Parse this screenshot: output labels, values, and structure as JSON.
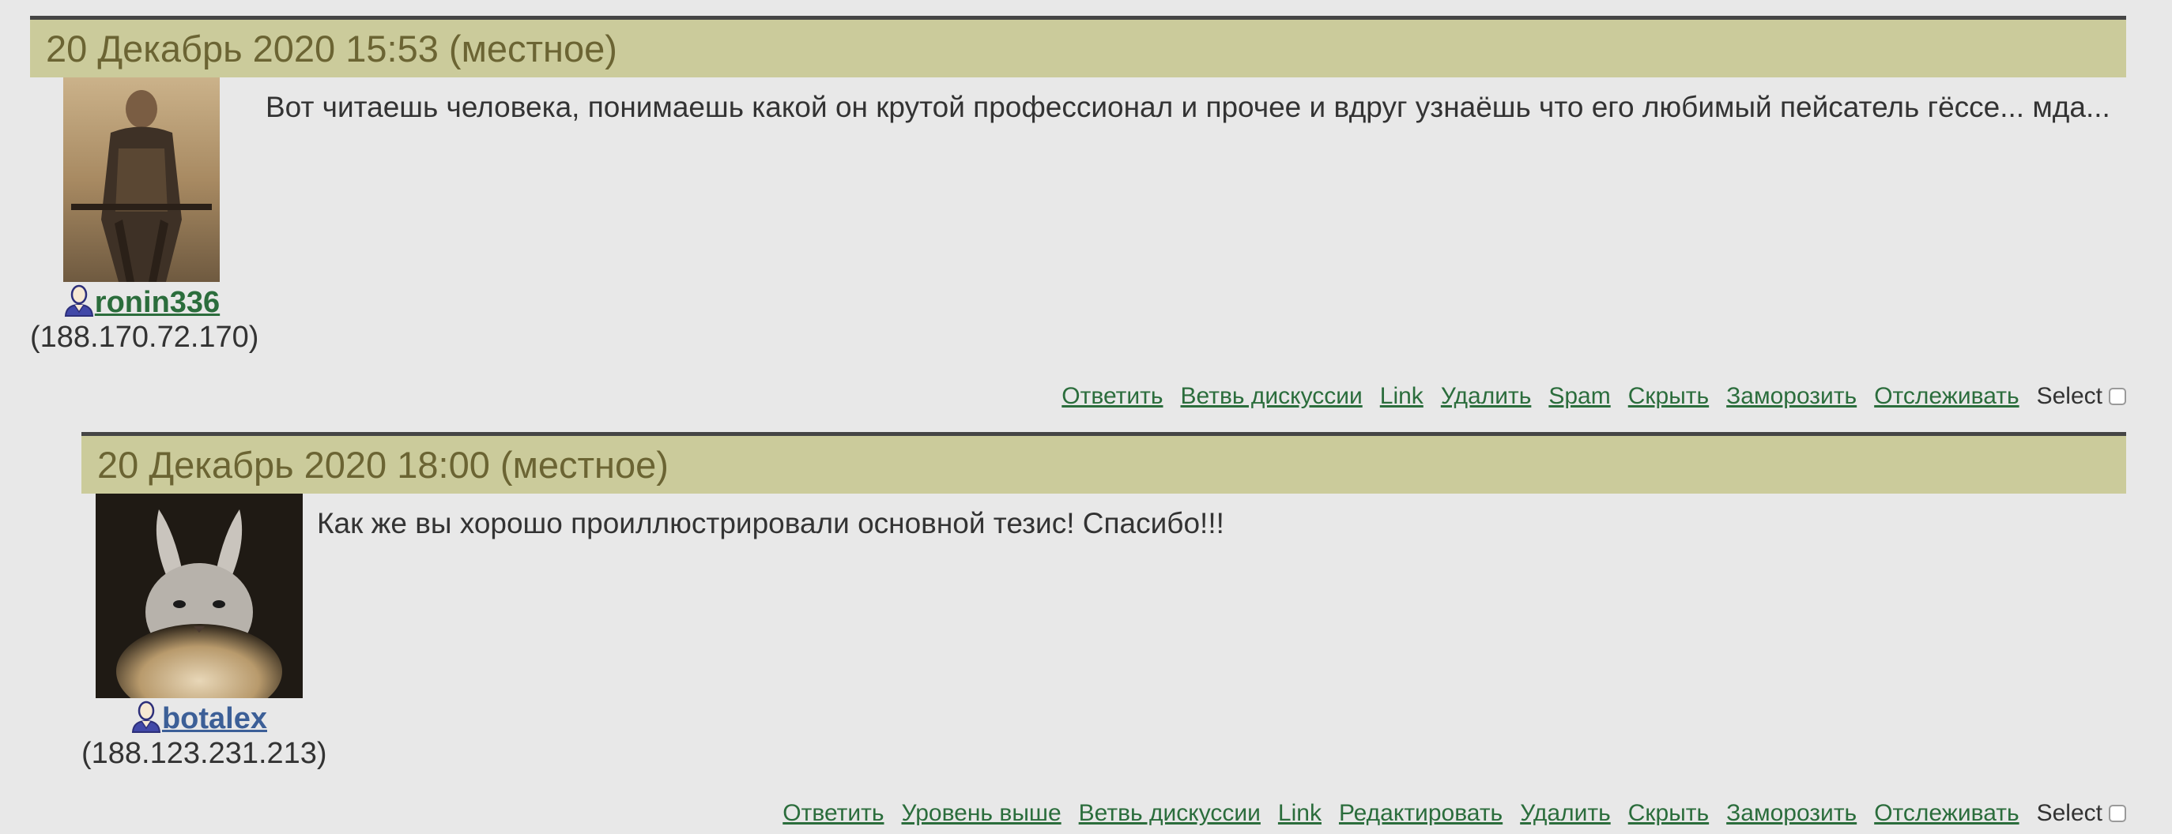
{
  "comments": [
    {
      "date": "20 Декабрь 2020 15:53 (местное)",
      "avatar_icon": "avatar-samurai",
      "user_icon": "user-icon",
      "username": "ronin336",
      "ip": "(188.170.72.170)",
      "text": "Вот читаешь человека, понимаешь какой он крутой профессионал и прочее и вдруг узнаёшь что его любимый пейсатель гёссе... мда...",
      "actions": [
        "Ответить",
        "Ветвь дискуссии",
        "Link",
        "Удалить",
        "Spam",
        "Скрыть",
        "Заморозить",
        "Отслеживать"
      ],
      "select_label": "Select",
      "username_color": "#2b6d3c"
    },
    {
      "date": "20 Декабрь 2020 18:00 (местное)",
      "avatar_icon": "avatar-chinchilla",
      "user_icon": "user-icon",
      "username": "botalex",
      "ip": "(188.123.231.213)",
      "text": "Как же вы хорошо проиллюстрировали основной тезис! Спасибо!!!",
      "actions": [
        "Ответить",
        "Уровень выше",
        "Ветвь дискуссии",
        "Link",
        "Редактировать",
        "Удалить",
        "Скрыть",
        "Заморозить",
        "Отслеживать"
      ],
      "select_label": "Select",
      "username_color": "#3c5f97"
    }
  ],
  "colors": {
    "page_background": "#e8e8e8",
    "header_background": "#cbcb9b",
    "header_text": "#6b6433",
    "header_border": "#454545",
    "link": "#2b6d3c"
  }
}
